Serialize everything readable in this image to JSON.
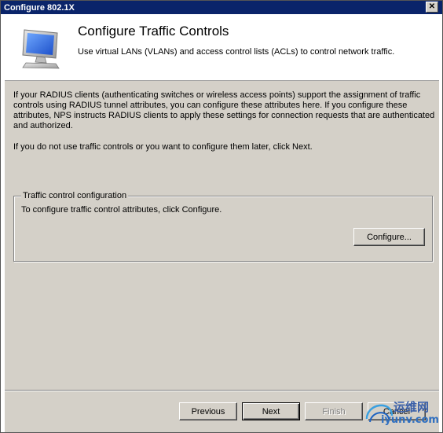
{
  "window": {
    "title": "Configure 802.1X",
    "close_glyph": "✕"
  },
  "header": {
    "title": "Configure Traffic Controls",
    "subtitle": "Use virtual LANs (VLANs) and access control lists (ACLs) to control network traffic.",
    "icon": "monitor-icon"
  },
  "body": {
    "paragraph1": "If your RADIUS clients (authenticating switches or wireless access points) support the assignment of traffic controls using RADIUS tunnel attributes, you can configure these attributes here. If you configure these attributes, NPS instructs RADIUS clients to apply these settings for connection requests that are authenticated and authorized.",
    "paragraph2": "If you do not use traffic controls or you want to configure them later, click Next."
  },
  "group": {
    "legend": "Traffic control configuration",
    "text": "To configure traffic control attributes, click Configure.",
    "configure_label": "Configure..."
  },
  "footer": {
    "previous_label": "Previous",
    "next_label": "Next",
    "finish_label": "Finish",
    "cancel_label": "Cancel"
  },
  "watermark": {
    "text_cn": "运维网",
    "url": "iyunv.com"
  }
}
